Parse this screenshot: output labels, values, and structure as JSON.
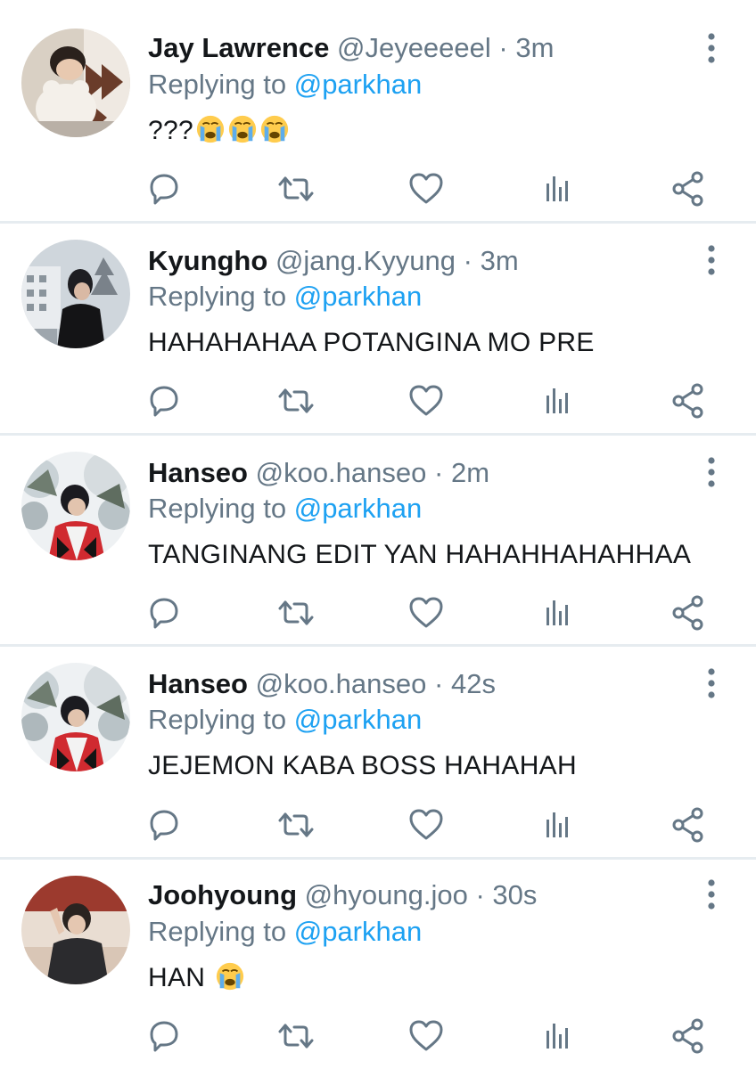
{
  "colors": {
    "accent": "#1da1f2",
    "secondary_text": "#657786",
    "primary_text": "#14171a",
    "divider": "#e6ecf0",
    "icon": "#657786"
  },
  "replies": [
    {
      "name": "Jay Lawrence",
      "handle": "@Jeyeeeeel",
      "dot": "·",
      "time": "3m",
      "replying_prefix": "Replying to",
      "replying_to": "@parkhan",
      "text": "???",
      "emojis": [
        "loudly-crying-face",
        "loudly-crying-face",
        "loudly-crying-face"
      ]
    },
    {
      "name": "Kyungho",
      "handle": "@jang.Kyyung",
      "dot": "·",
      "time": "3m",
      "replying_prefix": "Replying to",
      "replying_to": "@parkhan",
      "text": "HAHAHAHAA POTANGINA MO PRE",
      "emojis": []
    },
    {
      "name": "Hanseo",
      "handle": "@koo.hanseo",
      "dot": "·",
      "time": "2m",
      "replying_prefix": "Replying to",
      "replying_to": "@parkhan",
      "text": "TANGINANG EDIT YAN HAHAHHAHAHHAA",
      "emojis": []
    },
    {
      "name": "Hanseo",
      "handle": "@koo.hanseo",
      "dot": "·",
      "time": "42s",
      "replying_prefix": "Replying to",
      "replying_to": "@parkhan",
      "text": "JEJEMON KABA BOSS HAHAHAH",
      "emojis": []
    },
    {
      "name": "Joohyoung",
      "handle": "@hyoung.joo",
      "dot": "·",
      "time": "30s",
      "replying_prefix": "Replying to",
      "replying_to": "@parkhan",
      "text": "HAN ",
      "emojis": [
        "loudly-crying-face"
      ]
    }
  ],
  "action_icons": [
    "reply-icon",
    "retweet-icon",
    "like-icon",
    "analytics-icon",
    "share-icon"
  ],
  "overflow_icon": "more-vertical-icon"
}
